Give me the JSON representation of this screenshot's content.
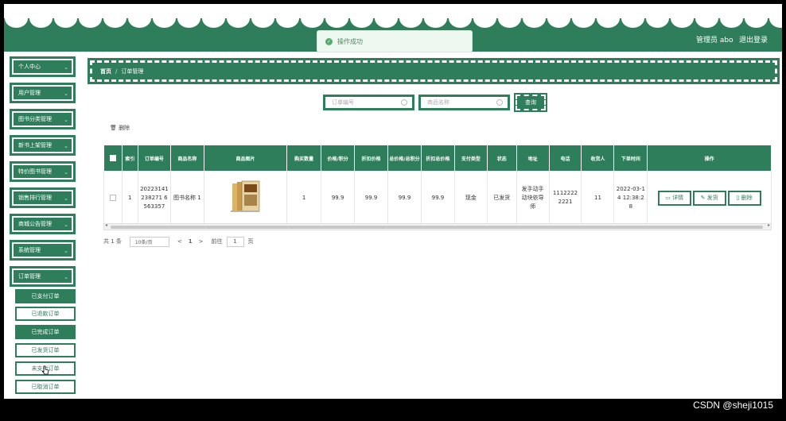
{
  "header": {
    "admin_label": "管理员 abo",
    "logout_label": "退出登录",
    "toast_message": "操作成功"
  },
  "sidebar": {
    "items": [
      {
        "label": "个人中心"
      },
      {
        "label": "用户管理"
      },
      {
        "label": "图书分类管理"
      },
      {
        "label": "新书上架管理"
      },
      {
        "label": "特价图书管理"
      },
      {
        "label": "销售排行管理"
      },
      {
        "label": "商城公告管理"
      },
      {
        "label": "系统管理"
      },
      {
        "label": "订单管理"
      }
    ],
    "sub_items": [
      {
        "label": "已支付订单"
      },
      {
        "label": "已退款订单"
      },
      {
        "label": "已完成订单"
      },
      {
        "label": "已发货订单"
      },
      {
        "label": "未支付订单"
      },
      {
        "label": "已取消订单"
      }
    ]
  },
  "breadcrumb": {
    "home": "首页",
    "separator": "/",
    "current": "订单管理"
  },
  "search": {
    "order_no_placeholder": "订单编号",
    "product_name_placeholder": "商品名称",
    "query_label": "查询"
  },
  "toolbar": {
    "delete_label": "删除"
  },
  "table": {
    "headers": [
      "索引",
      "订单编号",
      "商品名称",
      "商品图片",
      "购买数量",
      "价格/积分",
      "折扣价格",
      "总价格/总积分",
      "折扣总价格",
      "支付类型",
      "状态",
      "地址",
      "电话",
      "收货人",
      "下单时间",
      "操作"
    ],
    "rows": [
      {
        "index": "1",
        "order_no": "20223141238271 6563357",
        "product_name": "图书名称 1",
        "quantity": "1",
        "price": "99.9",
        "discount_price": "99.9",
        "total": "99.9",
        "discount_total": "99.9",
        "pay_type": "现金",
        "status": "已发货",
        "address": "发手动手动块依导师",
        "phone": "11122222221",
        "receiver": "11",
        "order_time": "2022-03-14 12:38:28",
        "actions": {
          "detail": "详情",
          "ship": "发货",
          "delete": "删除"
        }
      }
    ]
  },
  "pager": {
    "total": "共 1 条",
    "page_size": "10条/页",
    "prev": "<",
    "current_page": "1",
    "next": ">",
    "goto_label": "前往",
    "goto_value": "1",
    "page_suffix": "页"
  },
  "watermark": "CSDN @sheji1015",
  "colors": {
    "primary": "#2e7d5b",
    "toast_bg": "#edf8f0"
  }
}
